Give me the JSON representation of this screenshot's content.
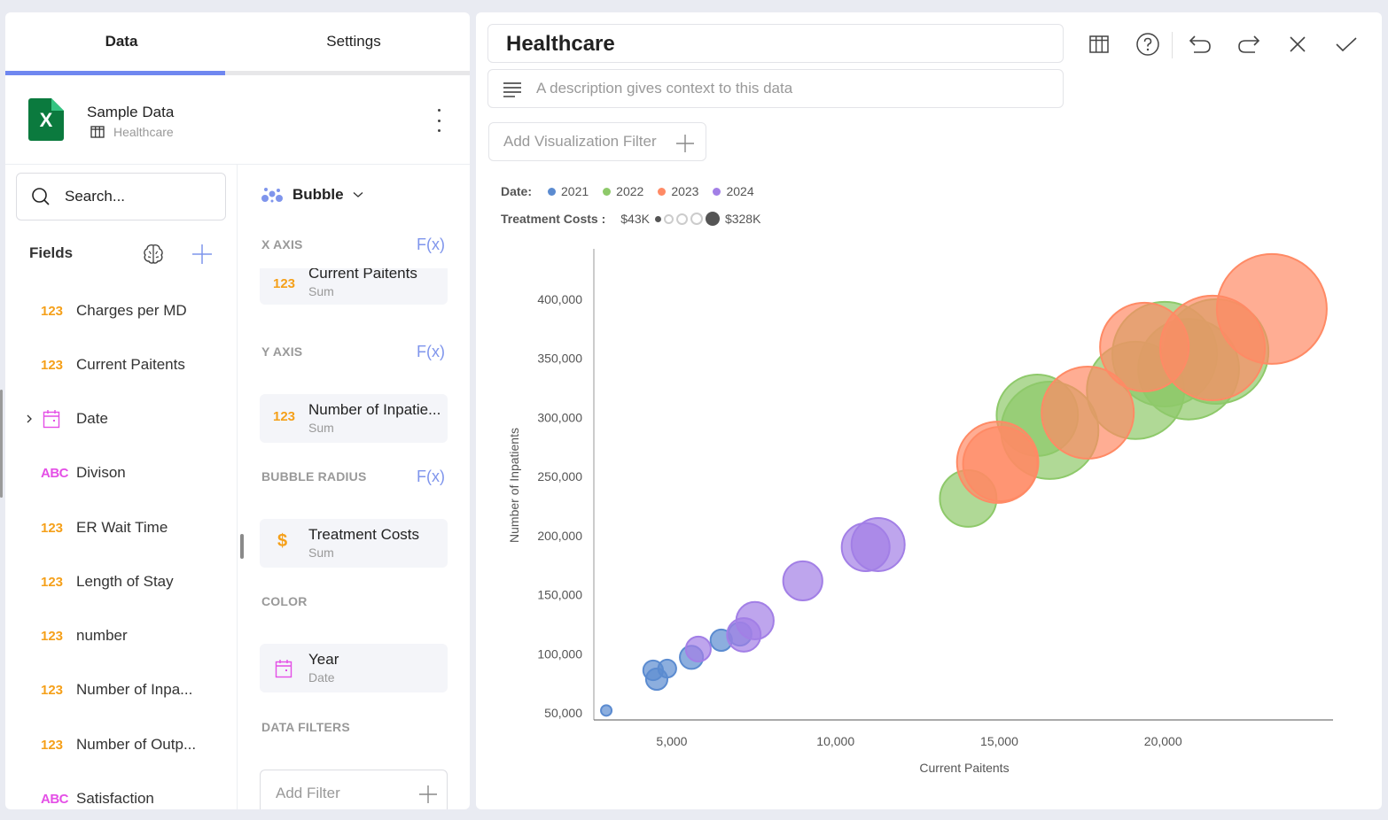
{
  "left_panel": {
    "tabs": [
      {
        "label": "Data",
        "active": true
      },
      {
        "label": "Settings",
        "active": false
      }
    ],
    "source": {
      "name": "Sample Data",
      "table": "Healthcare",
      "icon": "excel-icon",
      "icon_letter": "X"
    },
    "search": {
      "placeholder": "Search..."
    },
    "fields_title": "Fields",
    "fields": [
      {
        "type": "123",
        "kind": "number",
        "label": "Charges per MD"
      },
      {
        "type": "123",
        "kind": "number",
        "label": "Current Paitents"
      },
      {
        "type": "date",
        "kind": "date",
        "label": "Date",
        "expandable": true
      },
      {
        "type": "ABC",
        "kind": "text",
        "label": "Divison"
      },
      {
        "type": "123",
        "kind": "number",
        "label": "ER Wait Time"
      },
      {
        "type": "123",
        "kind": "number",
        "label": "Length of Stay"
      },
      {
        "type": "123",
        "kind": "number",
        "label": "number"
      },
      {
        "type": "123",
        "kind": "number",
        "label": "Number of Inpa..."
      },
      {
        "type": "123",
        "kind": "number",
        "label": "Number of Outp..."
      },
      {
        "type": "ABC",
        "kind": "text",
        "label": "Satisfaction"
      }
    ]
  },
  "config": {
    "chart_type": "Bubble",
    "fx_label": "F(x)",
    "sections": {
      "x_axis": {
        "title": "X AXIS",
        "field": "Current Paitents",
        "agg": "Sum",
        "type": "123"
      },
      "y_axis": {
        "title": "Y AXIS",
        "field": "Number of Inpatie...",
        "agg": "Sum",
        "type": "123"
      },
      "bubble_radius": {
        "title": "BUBBLE RADIUS",
        "field": "Treatment Costs",
        "agg": "Sum",
        "type": "$"
      },
      "color": {
        "title": "COLOR",
        "field": "Year",
        "agg": "Date"
      },
      "data_filters": {
        "title": "DATA FILTERS",
        "add_label": "Add Filter"
      }
    }
  },
  "editor": {
    "title": "Healthcare",
    "description_placeholder": "A description gives context to this data",
    "add_vis_filter": "Add Visualization Filter",
    "toolbar": [
      "table-view-icon",
      "help-icon",
      "undo-icon",
      "redo-icon",
      "close-icon",
      "confirm-check-icon"
    ]
  },
  "legend": {
    "color_title": "Date:",
    "size_title": "Treatment Costs :",
    "size_min": "$43K",
    "size_max": "$328K"
  },
  "chart_data": {
    "type": "scatter",
    "subtype": "bubble",
    "xlabel": "Current Paitents",
    "ylabel": "Number of Inpatients",
    "xlim": [
      2620,
      25190
    ],
    "ylim": [
      44000,
      442700
    ],
    "xticks": [
      5000,
      10000,
      15000,
      20000
    ],
    "xtick_labels": [
      "5,000",
      "10,000",
      "15,000",
      "20,000"
    ],
    "yticks": [
      50000,
      100000,
      150000,
      200000,
      250000,
      300000,
      350000,
      400000
    ],
    "ytick_labels": [
      "50,000",
      "100,000",
      "150,000",
      "200,000",
      "250,000",
      "300,000",
      "350,000",
      "400,000"
    ],
    "grid": false,
    "legend_position": "top-left",
    "size_range_k": [
      43,
      328
    ],
    "series": [
      {
        "name": "2021",
        "color": "#5b8bd0",
        "points": [
          {
            "x": 3000,
            "y": 52000,
            "size": 43
          },
          {
            "x": 4430,
            "y": 86000,
            "size": 69
          },
          {
            "x": 4540,
            "y": 78500,
            "size": 74
          },
          {
            "x": 4860,
            "y": 87500,
            "size": 64
          },
          {
            "x": 5600,
            "y": 97000,
            "size": 79
          },
          {
            "x": 6510,
            "y": 111500,
            "size": 74
          },
          {
            "x": 7080,
            "y": 116700,
            "size": 79
          }
        ]
      },
      {
        "name": "2024",
        "color": "#a27fe6",
        "points": [
          {
            "x": 5810,
            "y": 104000,
            "size": 84
          },
          {
            "x": 7200,
            "y": 116000,
            "size": 109
          },
          {
            "x": 7540,
            "y": 128000,
            "size": 120
          },
          {
            "x": 9000,
            "y": 161700,
            "size": 125
          },
          {
            "x": 10920,
            "y": 190200,
            "size": 150
          },
          {
            "x": 11300,
            "y": 192400,
            "size": 165
          }
        ]
      },
      {
        "name": "2022",
        "color": "#8ec96a",
        "points": [
          {
            "x": 14050,
            "y": 231400,
            "size": 175
          },
          {
            "x": 16160,
            "y": 301900,
            "size": 246
          },
          {
            "x": 16540,
            "y": 289100,
            "size": 292
          },
          {
            "x": 19160,
            "y": 322900,
            "size": 292
          },
          {
            "x": 20050,
            "y": 353600,
            "size": 313
          },
          {
            "x": 20780,
            "y": 340900,
            "size": 302
          },
          {
            "x": 21620,
            "y": 355800,
            "size": 313
          }
        ]
      },
      {
        "name": "2023",
        "color": "#ff8a65",
        "points": [
          {
            "x": 14950,
            "y": 262100,
            "size": 246
          },
          {
            "x": 15030,
            "y": 260600,
            "size": 226
          },
          {
            "x": 17700,
            "y": 304100,
            "size": 277
          },
          {
            "x": 19430,
            "y": 359600,
            "size": 267
          },
          {
            "x": 21510,
            "y": 358800,
            "size": 313
          },
          {
            "x": 23320,
            "y": 391800,
            "size": 328
          }
        ]
      }
    ],
    "legend_entries": [
      "2021",
      "2022",
      "2023",
      "2024"
    ]
  }
}
